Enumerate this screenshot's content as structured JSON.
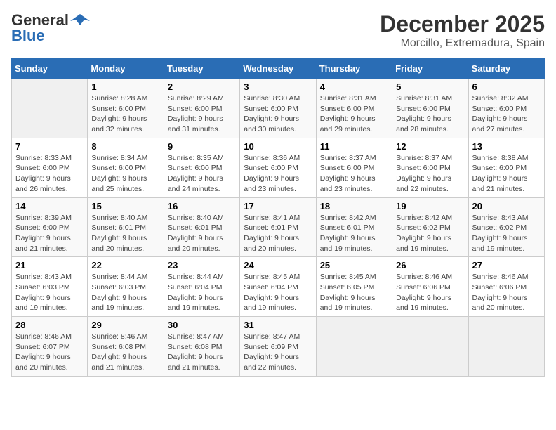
{
  "logo": {
    "line1": "General",
    "line2": "Blue"
  },
  "title": "December 2025",
  "subtitle": "Morcillo, Extremadura, Spain",
  "days_of_week": [
    "Sunday",
    "Monday",
    "Tuesday",
    "Wednesday",
    "Thursday",
    "Friday",
    "Saturday"
  ],
  "weeks": [
    [
      {
        "day": "",
        "info": ""
      },
      {
        "day": "1",
        "info": "Sunrise: 8:28 AM\nSunset: 6:00 PM\nDaylight: 9 hours\nand 32 minutes."
      },
      {
        "day": "2",
        "info": "Sunrise: 8:29 AM\nSunset: 6:00 PM\nDaylight: 9 hours\nand 31 minutes."
      },
      {
        "day": "3",
        "info": "Sunrise: 8:30 AM\nSunset: 6:00 PM\nDaylight: 9 hours\nand 30 minutes."
      },
      {
        "day": "4",
        "info": "Sunrise: 8:31 AM\nSunset: 6:00 PM\nDaylight: 9 hours\nand 29 minutes."
      },
      {
        "day": "5",
        "info": "Sunrise: 8:31 AM\nSunset: 6:00 PM\nDaylight: 9 hours\nand 28 minutes."
      },
      {
        "day": "6",
        "info": "Sunrise: 8:32 AM\nSunset: 6:00 PM\nDaylight: 9 hours\nand 27 minutes."
      }
    ],
    [
      {
        "day": "7",
        "info": "Sunrise: 8:33 AM\nSunset: 6:00 PM\nDaylight: 9 hours\nand 26 minutes."
      },
      {
        "day": "8",
        "info": "Sunrise: 8:34 AM\nSunset: 6:00 PM\nDaylight: 9 hours\nand 25 minutes."
      },
      {
        "day": "9",
        "info": "Sunrise: 8:35 AM\nSunset: 6:00 PM\nDaylight: 9 hours\nand 24 minutes."
      },
      {
        "day": "10",
        "info": "Sunrise: 8:36 AM\nSunset: 6:00 PM\nDaylight: 9 hours\nand 23 minutes."
      },
      {
        "day": "11",
        "info": "Sunrise: 8:37 AM\nSunset: 6:00 PM\nDaylight: 9 hours\nand 23 minutes."
      },
      {
        "day": "12",
        "info": "Sunrise: 8:37 AM\nSunset: 6:00 PM\nDaylight: 9 hours\nand 22 minutes."
      },
      {
        "day": "13",
        "info": "Sunrise: 8:38 AM\nSunset: 6:00 PM\nDaylight: 9 hours\nand 21 minutes."
      }
    ],
    [
      {
        "day": "14",
        "info": "Sunrise: 8:39 AM\nSunset: 6:00 PM\nDaylight: 9 hours\nand 21 minutes."
      },
      {
        "day": "15",
        "info": "Sunrise: 8:40 AM\nSunset: 6:01 PM\nDaylight: 9 hours\nand 20 minutes."
      },
      {
        "day": "16",
        "info": "Sunrise: 8:40 AM\nSunset: 6:01 PM\nDaylight: 9 hours\nand 20 minutes."
      },
      {
        "day": "17",
        "info": "Sunrise: 8:41 AM\nSunset: 6:01 PM\nDaylight: 9 hours\nand 20 minutes."
      },
      {
        "day": "18",
        "info": "Sunrise: 8:42 AM\nSunset: 6:01 PM\nDaylight: 9 hours\nand 19 minutes."
      },
      {
        "day": "19",
        "info": "Sunrise: 8:42 AM\nSunset: 6:02 PM\nDaylight: 9 hours\nand 19 minutes."
      },
      {
        "day": "20",
        "info": "Sunrise: 8:43 AM\nSunset: 6:02 PM\nDaylight: 9 hours\nand 19 minutes."
      }
    ],
    [
      {
        "day": "21",
        "info": "Sunrise: 8:43 AM\nSunset: 6:03 PM\nDaylight: 9 hours\nand 19 minutes."
      },
      {
        "day": "22",
        "info": "Sunrise: 8:44 AM\nSunset: 6:03 PM\nDaylight: 9 hours\nand 19 minutes."
      },
      {
        "day": "23",
        "info": "Sunrise: 8:44 AM\nSunset: 6:04 PM\nDaylight: 9 hours\nand 19 minutes."
      },
      {
        "day": "24",
        "info": "Sunrise: 8:45 AM\nSunset: 6:04 PM\nDaylight: 9 hours\nand 19 minutes."
      },
      {
        "day": "25",
        "info": "Sunrise: 8:45 AM\nSunset: 6:05 PM\nDaylight: 9 hours\nand 19 minutes."
      },
      {
        "day": "26",
        "info": "Sunrise: 8:46 AM\nSunset: 6:06 PM\nDaylight: 9 hours\nand 19 minutes."
      },
      {
        "day": "27",
        "info": "Sunrise: 8:46 AM\nSunset: 6:06 PM\nDaylight: 9 hours\nand 20 minutes."
      }
    ],
    [
      {
        "day": "28",
        "info": "Sunrise: 8:46 AM\nSunset: 6:07 PM\nDaylight: 9 hours\nand 20 minutes."
      },
      {
        "day": "29",
        "info": "Sunrise: 8:46 AM\nSunset: 6:08 PM\nDaylight: 9 hours\nand 21 minutes."
      },
      {
        "day": "30",
        "info": "Sunrise: 8:47 AM\nSunset: 6:08 PM\nDaylight: 9 hours\nand 21 minutes."
      },
      {
        "day": "31",
        "info": "Sunrise: 8:47 AM\nSunset: 6:09 PM\nDaylight: 9 hours\nand 22 minutes."
      },
      {
        "day": "",
        "info": ""
      },
      {
        "day": "",
        "info": ""
      },
      {
        "day": "",
        "info": ""
      }
    ]
  ]
}
